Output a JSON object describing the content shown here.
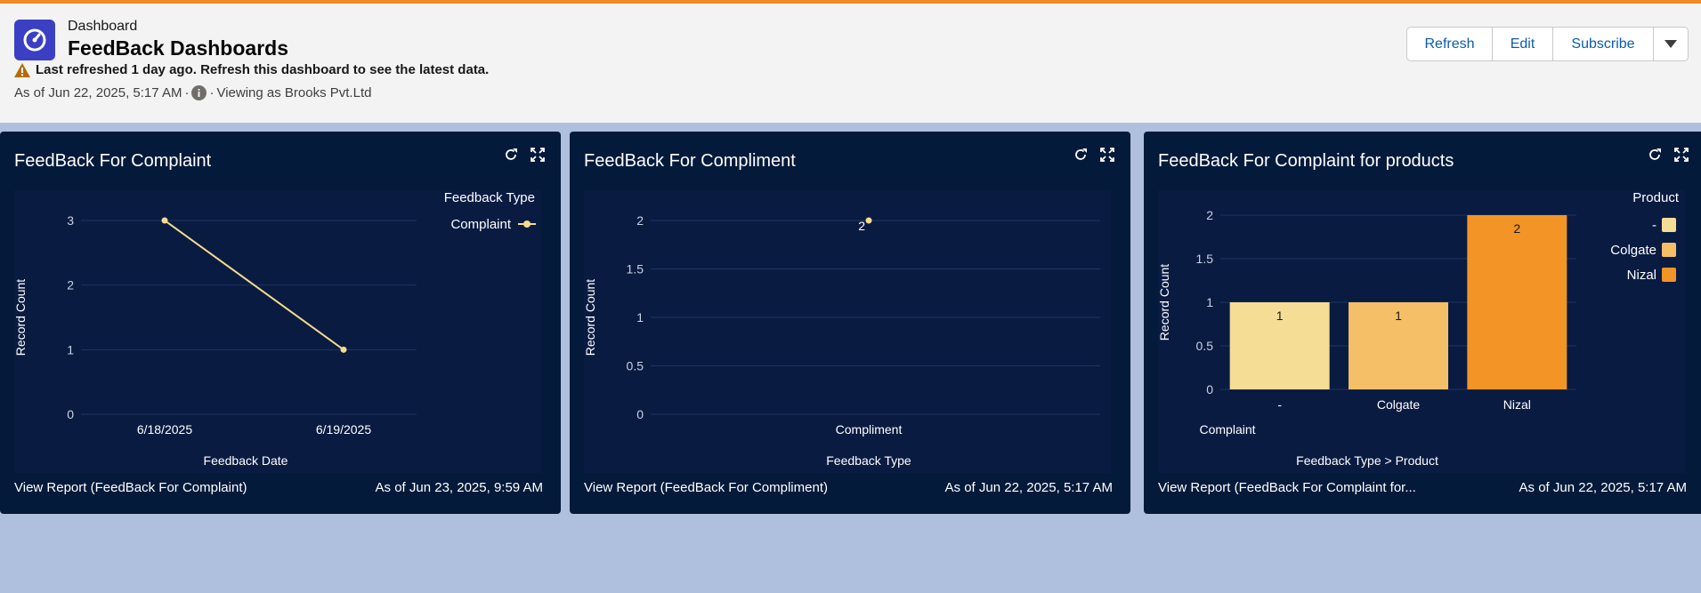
{
  "header": {
    "eyebrow": "Dashboard",
    "title": "FeedBack Dashboards",
    "warning": "Last refreshed 1 day ago. Refresh this dashboard to see the latest data.",
    "as_of": "As of Jun 22, 2025, 5:17 AM",
    "viewing_as": "Viewing as Brooks Pvt.Ltd",
    "buttons": {
      "refresh": "Refresh",
      "edit": "Edit",
      "subscribe": "Subscribe"
    }
  },
  "colors": {
    "accent": "#f08a24",
    "link": "#0b5cab",
    "panel_bg": "#041a3a",
    "chart_bg": "#0a1b42"
  },
  "panels": [
    {
      "title": "FeedBack For Complaint",
      "footer_link": "View Report (FeedBack For Complaint)",
      "footer_time": "As of Jun 23, 2025, 9:59 AM"
    },
    {
      "title": "FeedBack For Compliment",
      "footer_link": "View Report (FeedBack For Compliment)",
      "footer_time": "As of Jun 22, 2025, 5:17 AM"
    },
    {
      "title": "FeedBack For Complaint for products",
      "footer_link": "View Report (FeedBack For Complaint for...",
      "footer_time": "As of Jun 22, 2025, 5:17 AM"
    }
  ],
  "chart_data": [
    {
      "type": "line",
      "x": [
        "6/18/2025",
        "6/19/2025"
      ],
      "series": [
        {
          "name": "Complaint",
          "values": [
            3,
            1
          ],
          "color": "#f5dc8a"
        }
      ],
      "xlabel": "Feedback Date",
      "ylabel": "Record Count",
      "yticks": [
        "0",
        "1",
        "2",
        "3"
      ],
      "ylim": [
        0,
        3
      ],
      "legend_title": "Feedback Type",
      "legend_position": "top-right",
      "grid": true
    },
    {
      "type": "scatter",
      "x": [
        "Compliment"
      ],
      "series": [
        {
          "values": [
            2
          ],
          "color": "#f5dc8a"
        }
      ],
      "data_labels": [
        "2"
      ],
      "xlabel": "Feedback Type",
      "ylabel": "Record Count",
      "yticks": [
        "0",
        "0.5",
        "1",
        "1.5",
        "2"
      ],
      "ylim": [
        0,
        2
      ],
      "grid": true
    },
    {
      "type": "bar",
      "group": "Complaint",
      "categories": [
        "-",
        "Colgate",
        "Nizal"
      ],
      "values": [
        1,
        1,
        2
      ],
      "data_labels": [
        "1",
        "1",
        "2"
      ],
      "colors": [
        "#f5dd95",
        "#f4bf66",
        "#f39426"
      ],
      "xlabel": "Feedback Type",
      "xlabel_separator": ">",
      "xlabel_2": "Product",
      "ylabel": "Record Count",
      "yticks": [
        "0",
        "0.5",
        "1",
        "1.5",
        "2"
      ],
      "ylim": [
        0,
        2
      ],
      "legend_title": "Product",
      "legend_position": "top-right",
      "grid": true
    }
  ]
}
